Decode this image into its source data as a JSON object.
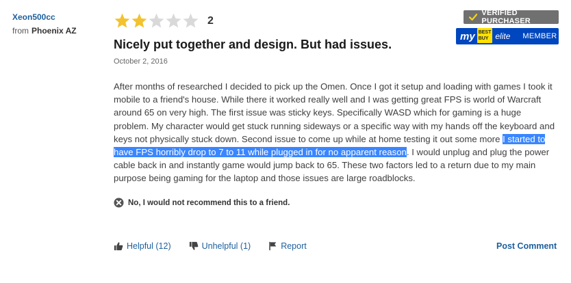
{
  "reviewer": {
    "name": "Xeon500cc",
    "from_label": "from",
    "location": "Phoenix AZ"
  },
  "rating": {
    "value": 2,
    "max": 5,
    "display": "2",
    "filled_color": "#f2c22f",
    "empty_color": "#d9d9d9"
  },
  "review": {
    "title": "Nicely put together and design. But had issues.",
    "date": "October 2, 2016",
    "body_before": "After months of researched I decided to pick up the Omen. Once I got it setup and loading with games I took it mobile to a friend's house. While there it worked really well and I was getting great FPS is world of Warcraft around 65 on very high. The first issue was sticky keys. Specifically WASD which for gaming is a huge problem. My character would get stuck running sideways or a specific way with my hands off the keyboard and keys not physically stuck down. Second issue to come up while at home testing it out some more ",
    "body_highlighted": "I started to have FPS horribly drop to 7 to 11 while plugged in for no apparent reason",
    "body_after": ". I would unplug and plug the power cable back in and instantly game would jump back to 65. These two factors led to a return due to my main purpose being gaming for the laptop and those issues are large roadblocks.",
    "selection_color": "#3a86ff"
  },
  "recommendation": {
    "text": "No, I would not recommend this to a friend.",
    "icon": "x-circle-icon"
  },
  "actions": {
    "helpful": "Helpful (12)",
    "unhelpful": "Unhelpful (1)",
    "report": "Report",
    "post_comment": "Post Comment"
  },
  "badges": {
    "verified": "VERIFIED PURCHASER",
    "my": "my",
    "best_buy_tag": "BEST BUY",
    "elite": "elite",
    "member": "MEMBER",
    "verified_color": "#707070",
    "member_color": "#0046be"
  }
}
